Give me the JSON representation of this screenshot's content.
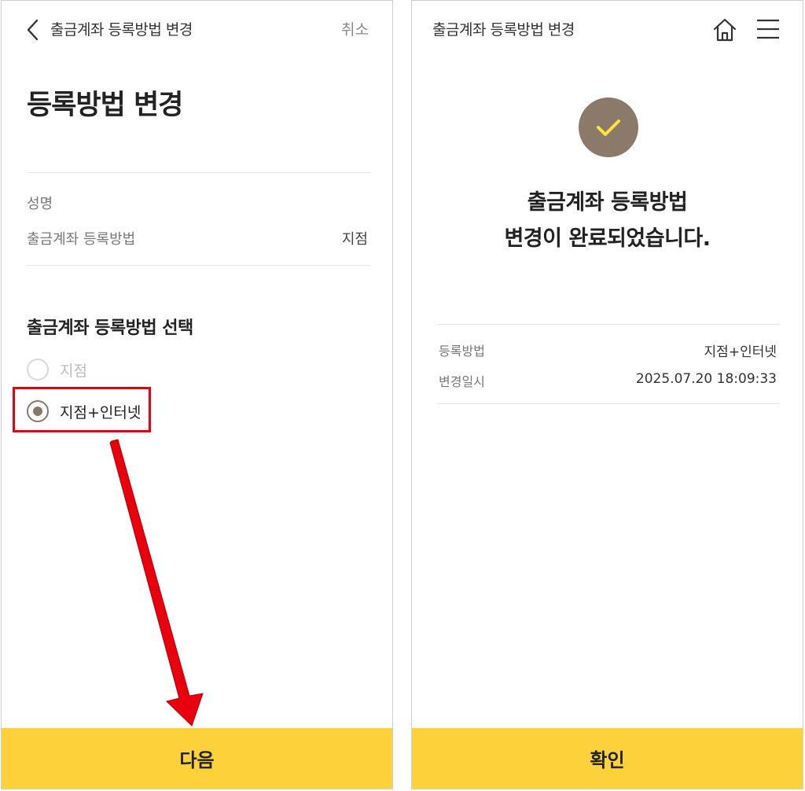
{
  "left_screen": {
    "header": {
      "title": "출금계좌 등록방법 변경",
      "cancel_label": "취소"
    },
    "page_title": "등록방법 변경",
    "info": {
      "name_label": "성명",
      "method_label": "출금계좌 등록방법",
      "method_value": "지점"
    },
    "section_title": "출금계좌 등록방법 선택",
    "options": [
      {
        "label": "지점",
        "selected": false
      },
      {
        "label": "지점+인터넷",
        "selected": true
      }
    ],
    "next_button": "다음"
  },
  "right_screen": {
    "header": {
      "title": "출금계좌 등록방법 변경"
    },
    "completion": {
      "line1": "출금계좌 등록방법",
      "line2": "변경이 완료되었습니다."
    },
    "details": [
      {
        "label": "등록방법",
        "value": "지점+인터넷"
      },
      {
        "label": "변경일시",
        "value": "2025.07.20 18:09:33"
      }
    ],
    "confirm_button": "확인"
  },
  "colors": {
    "accent_yellow": "#fdd13a",
    "brand_brown": "#8b7a6a",
    "check_yellow": "#ffe33d",
    "annotation_red": "#e8000c"
  },
  "icons": [
    "back-chevron-icon",
    "home-icon",
    "hamburger-menu-icon",
    "check-icon"
  ]
}
